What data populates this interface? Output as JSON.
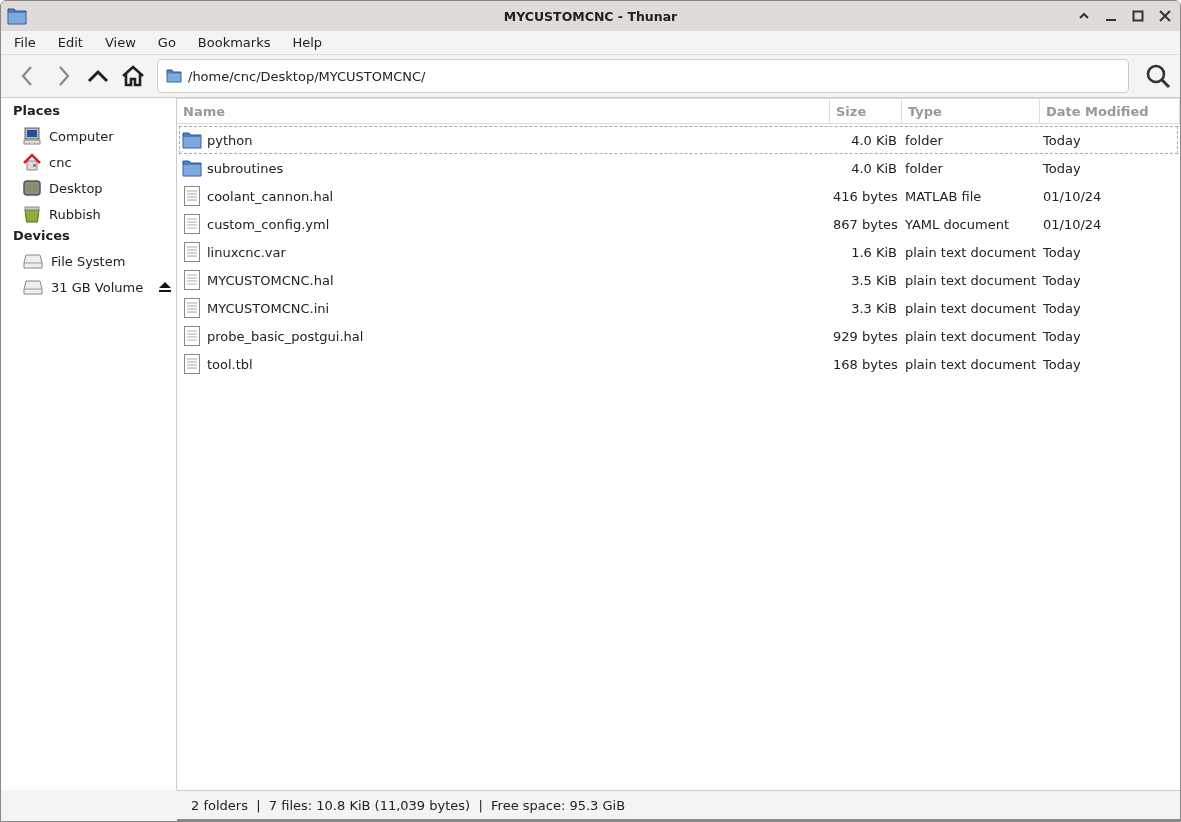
{
  "window": {
    "title": "MYCUSTOMCNC - Thunar"
  },
  "menu": [
    "File",
    "Edit",
    "View",
    "Go",
    "Bookmarks",
    "Help"
  ],
  "location": {
    "path": "/home/cnc/Desktop/MYCUSTOMCNC/"
  },
  "sidebar": [
    {
      "heading": "Places",
      "items": [
        {
          "label": "Computer",
          "kind": "computer",
          "eject": false
        },
        {
          "label": "cnc",
          "kind": "home",
          "eject": false
        },
        {
          "label": "Desktop",
          "kind": "desktop",
          "eject": false
        },
        {
          "label": "Rubbish",
          "kind": "trash",
          "eject": false
        }
      ]
    },
    {
      "heading": "Devices",
      "items": [
        {
          "label": "File System",
          "kind": "drive",
          "eject": false
        },
        {
          "label": "31 GB Volume",
          "kind": "drive",
          "eject": true
        }
      ]
    }
  ],
  "table": {
    "columns": [
      "Name",
      "Size",
      "Type",
      "Date Modified"
    ],
    "rows": [
      {
        "kind": "folder",
        "name": "python",
        "size": "4.0 KiB",
        "type": "folder",
        "date": "Today",
        "focused": true
      },
      {
        "kind": "folder",
        "name": "subroutines",
        "size": "4.0 KiB",
        "type": "folder",
        "date": "Today",
        "focused": false
      },
      {
        "kind": "file",
        "name": "coolant_cannon.hal",
        "size": "416 bytes",
        "type": "MATLAB file",
        "date": "01/10/24",
        "focused": false
      },
      {
        "kind": "file",
        "name": "custom_config.yml",
        "size": "867 bytes",
        "type": "YAML document",
        "date": "01/10/24",
        "focused": false
      },
      {
        "kind": "file",
        "name": "linuxcnc.var",
        "size": "1.6 KiB",
        "type": "plain text document",
        "date": "Today",
        "focused": false
      },
      {
        "kind": "file",
        "name": "MYCUSTOMCNC.hal",
        "size": "3.5 KiB",
        "type": "plain text document",
        "date": "Today",
        "focused": false
      },
      {
        "kind": "file",
        "name": "MYCUSTOMCNC.ini",
        "size": "3.3 KiB",
        "type": "plain text document",
        "date": "Today",
        "focused": false
      },
      {
        "kind": "file",
        "name": "probe_basic_postgui.hal",
        "size": "929 bytes",
        "type": "plain text document",
        "date": "Today",
        "focused": false
      },
      {
        "kind": "file",
        "name": "tool.tbl",
        "size": "168 bytes",
        "type": "plain text document",
        "date": "Today",
        "focused": false
      }
    ]
  },
  "status_bar": "2 folders  |  7 files: 10.8 KiB (11,039 bytes)  |  Free space: 95.3 GiB"
}
